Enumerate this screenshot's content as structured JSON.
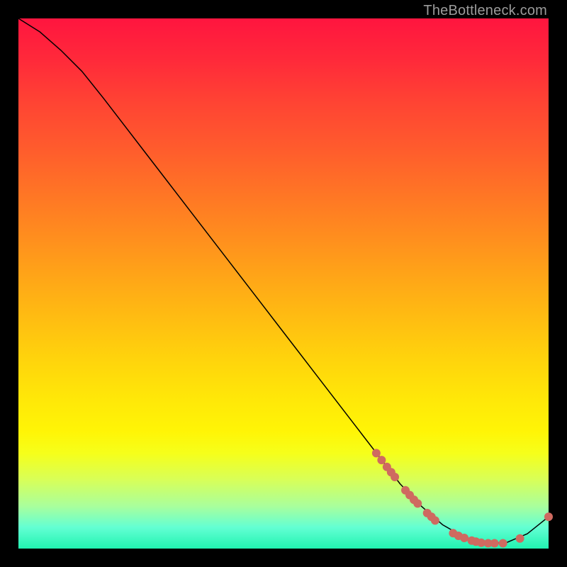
{
  "watermark": "TheBottleneck.com",
  "chart_data": {
    "type": "line",
    "title": "",
    "xlabel": "",
    "ylabel": "",
    "xlim": [
      0,
      100
    ],
    "ylim": [
      0,
      100
    ],
    "grid": false,
    "series": [
      {
        "name": "bottleneck-curve",
        "x": [
          0,
          4,
          8,
          12,
          16,
          20,
          24,
          28,
          32,
          36,
          40,
          44,
          48,
          52,
          56,
          60,
          64,
          68,
          72,
          76,
          80,
          84,
          88,
          92,
          96,
          100
        ],
        "y": [
          100,
          97.5,
          94,
          90,
          85,
          79.8,
          74.6,
          69.4,
          64.2,
          59,
          53.8,
          48.6,
          43.4,
          38.2,
          33,
          27.8,
          22.6,
          17.4,
          12.2,
          8,
          4.5,
          2.2,
          1.0,
          1.1,
          2.8,
          6.0
        ]
      }
    ],
    "scatter_points": {
      "name": "highlighted-dots",
      "color": "#cf6a60",
      "radius_px": 5.5,
      "points": [
        {
          "x": 67.5,
          "y": 18.0
        },
        {
          "x": 68.5,
          "y": 16.7
        },
        {
          "x": 69.5,
          "y": 15.4
        },
        {
          "x": 70.3,
          "y": 14.4
        },
        {
          "x": 71.0,
          "y": 13.5
        },
        {
          "x": 73.0,
          "y": 11.0
        },
        {
          "x": 73.8,
          "y": 10.1
        },
        {
          "x": 74.6,
          "y": 9.2
        },
        {
          "x": 75.3,
          "y": 8.5
        },
        {
          "x": 77.1,
          "y": 6.7
        },
        {
          "x": 77.9,
          "y": 6.0
        },
        {
          "x": 78.6,
          "y": 5.3
        },
        {
          "x": 82.0,
          "y": 2.9
        },
        {
          "x": 83.0,
          "y": 2.4
        },
        {
          "x": 84.1,
          "y": 2.0
        },
        {
          "x": 85.5,
          "y": 1.5
        },
        {
          "x": 86.3,
          "y": 1.3
        },
        {
          "x": 87.3,
          "y": 1.1
        },
        {
          "x": 88.6,
          "y": 1.0
        },
        {
          "x": 89.8,
          "y": 1.0
        },
        {
          "x": 91.4,
          "y": 1.0
        },
        {
          "x": 94.6,
          "y": 1.9
        },
        {
          "x": 100.0,
          "y": 6.0
        }
      ]
    }
  }
}
